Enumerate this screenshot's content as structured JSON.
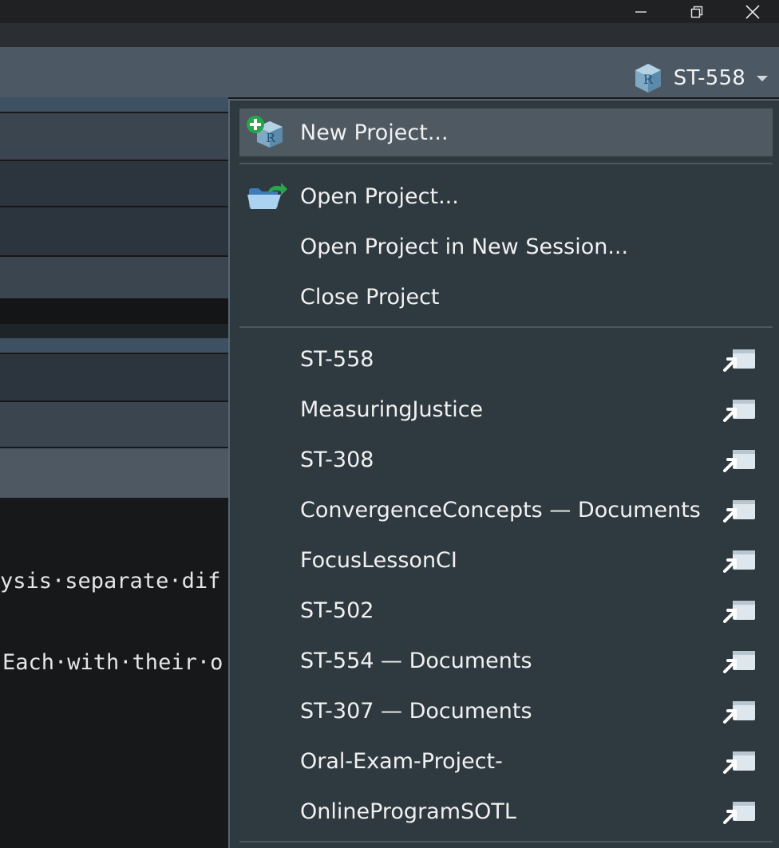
{
  "project_button": {
    "label": "ST-558",
    "icon": "r-project-cube-icon"
  },
  "editor": {
    "line1": "ysis·separate·dif",
    "line2": "Each·with·their·o"
  },
  "menu": {
    "new_project": "New Project...",
    "open_project": "Open Project...",
    "open_project_new_session": "Open Project in New Session...",
    "close_project": "Close Project",
    "recent": [
      {
        "label": "ST-558"
      },
      {
        "label": "MeasuringJustice"
      },
      {
        "label": "ST-308"
      },
      {
        "label": "ConvergenceConcepts — Documents"
      },
      {
        "label": "FocusLessonCI"
      },
      {
        "label": "ST-502"
      },
      {
        "label": "ST-554 — Documents"
      },
      {
        "label": "ST-307 — Documents"
      },
      {
        "label": "Oral-Exam-Project-"
      },
      {
        "label": "OnlineProgramSOTL"
      }
    ]
  },
  "colors": {
    "menu_bg": "#2f3940",
    "highlight": "#4e5961",
    "toolbar": "#4c5964",
    "accent_green": "#27a64b"
  }
}
